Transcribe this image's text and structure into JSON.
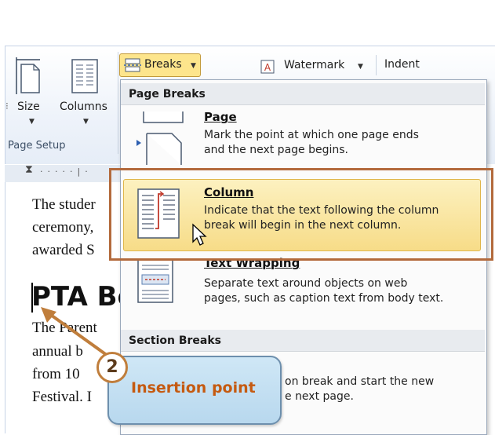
{
  "ribbon": {
    "size_label": "Size",
    "columns_label": "Columns",
    "group_label": "Page Setup",
    "breaks_label": "Breaks",
    "watermark_label": "Watermark",
    "indent_label": "Indent"
  },
  "document": {
    "lines_top": [
      "The studer",
      "ceremony,",
      "awarded S"
    ],
    "heading": "PTA Bo",
    "lines_bottom": [
      "The Parent",
      "annual b",
      "from 10",
      "Festival. I"
    ]
  },
  "menu": {
    "page_breaks_header": "Page Breaks",
    "section_breaks_header": "Section Breaks",
    "items": [
      {
        "title": "Page",
        "desc_lines": [
          "Mark the point at which one page ends",
          "and the next page begins."
        ]
      },
      {
        "title": "Column",
        "desc_lines": [
          "Indicate that the text following the column",
          "break will begin in the next column."
        ]
      },
      {
        "title": "Text Wrapping",
        "desc_lines": [
          "Separate text around objects on web",
          "pages, such as caption text from body text."
        ]
      }
    ],
    "next_page_desc_lines": [
      "on break and start the new",
      "e next page."
    ]
  },
  "callout": {
    "step": "2",
    "text": "Insertion point"
  },
  "colors": {
    "highlight_frame": "#b36a3c",
    "callout_text": "#c55a11",
    "breaks_button": "#fde58c"
  }
}
